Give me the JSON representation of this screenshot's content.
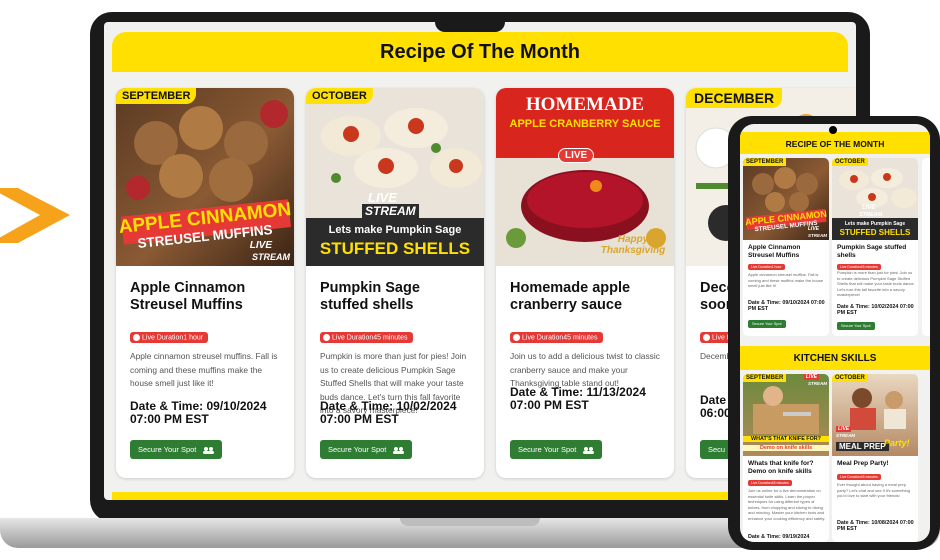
{
  "laptop": {
    "banner_title": "Recipe Of The Month",
    "cards": [
      {
        "month": "SEPTEMBER",
        "image_text_1": "APPLE CINNAMON",
        "image_text_2": "STREUSEL MUFFINS",
        "live_label": "LIVE",
        "stream_label": "STREAM",
        "title": "Apple Cinnamon Streusel Muffins",
        "duration": "Live Duration1 hour",
        "description": "Apple cinnamon streusel muffins. Fall is coming and these muffins make the house smell just like it!",
        "datetime": "Date & Time: 09/10/2024 07:00 PM EST",
        "button": "Secure Your Spot"
      },
      {
        "month": "OCTOBER",
        "live_label": "LIVE",
        "stream_label": "STREAM",
        "image_text_1": "Lets make Pumpkin Sage",
        "image_text_2": "STUFFED SHELLS",
        "title": "Pumpkin Sage stuffed shells",
        "duration": "Live Duration45 minutes",
        "description": "Pumpkin is more than just for pies! Join us to create delicious Pumpkin Sage Stuffed Shells that will make your taste buds dance. Let's turn this fall favorite into a savory masterpiece!",
        "datetime": "Date & Time: 10/02/2024 07:00 PM EST",
        "button": "Secure Your Spot"
      },
      {
        "image_text_1": "HOMEMADE",
        "image_text_2": "APPLE CRANBERRY SAUCE",
        "live_label": "LIVE",
        "image_text_3": "Happy Thanksgiving",
        "title": "Homemade apple cranberry sauce",
        "duration": "Live Duration45 minutes",
        "description": "Join us to add a delicious twist to classic cranberry sauce and make your Thanksgiving table stand out!",
        "datetime": "Date & Time: 11/13/2024 07:00 PM EST",
        "button": "Secure Your Spot"
      },
      {
        "month": "DECEMBER",
        "title": "Dece soon",
        "duration": "Live D",
        "description": "Decemb",
        "datetime": "Date & 06:00",
        "button": "Secu"
      }
    ]
  },
  "phone": {
    "recipe_banner": "RECIPE OF THE MONTH",
    "recipe_cards": [
      {
        "month": "SEPTEMBER",
        "image_text_1": "APPLE CINNAMON",
        "image_text_2": "STREUSEL MUFFINS",
        "live_label": "LIVE",
        "stream_label": "STREAM",
        "title": "Apple Cinnamon Streusel Muffins",
        "duration": "Live Duration1 hour",
        "description": "Apple cinnamon streusel muffins. Fall is coming and these muffins make the house smell just like it!",
        "datetime": "Date & Time: 09/10/2024 07:00 PM EST",
        "button": "Secure Your Spot"
      },
      {
        "month": "OCTOBER",
        "live_label": "LIVE",
        "stream_label": "STREAM",
        "image_text_1": "Lets make Pumpkin Sage",
        "image_text_2": "STUFFED SHELLS",
        "title": "Pumpkin Sage stuffed shells",
        "duration": "Live Duration45 minutes",
        "description": "Pumpkin is more than just for pies! Join us to create delicious Pumpkin Sage Stuffed Shells that will make your taste buds dance. Let's turn this fall favorite into a savory masterpiece!",
        "datetime": "Date & Time: 10/02/2024 07:00 PM EST",
        "button": "Secure Your Spot"
      }
    ],
    "skills_banner": "KITCHEN SKILLS",
    "skills_cards": [
      {
        "month": "SEPTEMBER",
        "live_label": "LIVE",
        "stream_label": "STREAM",
        "image_text_1": "WHAT'S THAT KNIFE FOR?",
        "image_text_2": "Demo on knife skills",
        "title": "Whats that knife for? Demo on knife skills",
        "duration": "Live Duration45 minutes",
        "description": "Join us online for a live demonstration on essential knife skills. Learn the proper techniques for using different types of knives, from chopping and slicing to dicing and mincing. Master your kitchen tools and enhance your cooking efficiency and safety.",
        "datetime": "Date & Time: 09/19/2024"
      },
      {
        "month": "OCTOBER",
        "live_label": "LIVE",
        "stream_label": "STREAM",
        "image_text_1": "MEAL PREP",
        "image_text_2": "Party!",
        "title": "Meal Prep Party!",
        "duration": "Live Duration45 minutes",
        "description": "Ever thought about having a meal prep party? Let's chat and see if it's something you'd love to start with your friends!",
        "datetime": "Date & Time: 10/08/2024 07:00 PM EST"
      }
    ]
  },
  "colors": {
    "brand_yellow": "#ffe000",
    "live_red": "#e53935",
    "button_green": "#2e7d32",
    "arrow_orange": "#f6a21a"
  }
}
